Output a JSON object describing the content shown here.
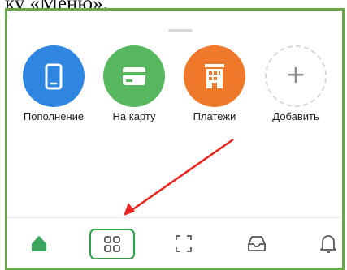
{
  "document": {
    "instruction_fragment": "ку «Меню»."
  },
  "quick_actions": [
    {
      "label": "Пополнение",
      "icon": "phone-icon",
      "color": "#2f86e0"
    },
    {
      "label": "На карту",
      "icon": "card-icon",
      "color": "#56b75e"
    },
    {
      "label": "Платежи",
      "icon": "building-icon",
      "color": "#f0782a"
    },
    {
      "label": "Добавить",
      "icon": "plus-icon",
      "color": "#d8d8d8"
    }
  ],
  "tab_bar": {
    "tabs": [
      {
        "name": "home",
        "icon": "home-icon",
        "active": true
      },
      {
        "name": "menu",
        "icon": "menu-grid-icon",
        "active": false,
        "highlighted": true
      },
      {
        "name": "scan",
        "icon": "scan-icon",
        "active": false
      },
      {
        "name": "inbox",
        "icon": "inbox-icon",
        "active": false
      },
      {
        "name": "notifications",
        "icon": "bell-icon",
        "active": false
      }
    ],
    "active_color": "#3aa55a",
    "inactive_color": "#555555"
  },
  "annotation": {
    "arrow_color": "#e8231e",
    "highlight_color": "#2e9f4a",
    "frame_color": "#69a849"
  }
}
